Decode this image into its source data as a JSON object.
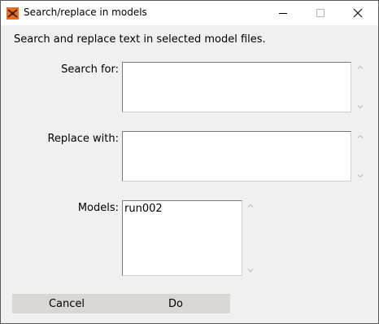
{
  "window": {
    "title": "Search/replace in models",
    "brand_color": "#e86c1a"
  },
  "titlebar_icons": [
    "app-icon",
    "minimize-icon",
    "maximize-icon",
    "close-icon"
  ],
  "dialog": {
    "instructions": "Search and replace text in selected model files.",
    "search_label": "Search for:",
    "search_value": "",
    "replace_label": "Replace with:",
    "replace_value": "",
    "models_label": "Models:",
    "models_items": [
      "run002"
    ]
  },
  "buttons": {
    "cancel": "Cancel",
    "do": "Do"
  }
}
